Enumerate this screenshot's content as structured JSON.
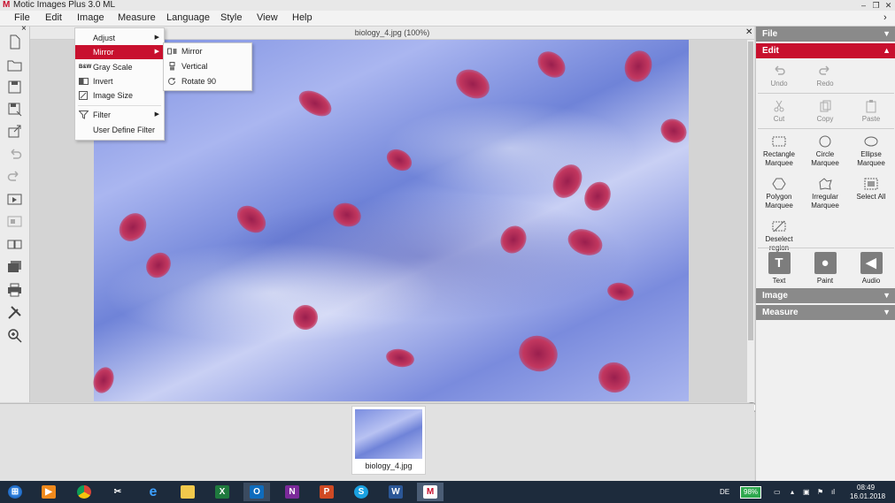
{
  "window": {
    "title": "Motic Images Plus 3.0 ML",
    "logo_text": "M",
    "minimize": "–",
    "restore": "❐",
    "close": "✕"
  },
  "menubar": {
    "items": [
      "File",
      "Edit",
      "Image",
      "Measure",
      "Language",
      "Style",
      "View",
      "Help"
    ],
    "right_chevron": "›"
  },
  "left_toolbar": {
    "icons": [
      "new-file-icon",
      "open-folder-icon",
      "save-icon",
      "save-as-icon",
      "export-icon",
      "undo-icon",
      "redo-icon",
      "slideshow-icon",
      "compare-icon",
      "dual-view-icon",
      "gallery-icon",
      "print-icon",
      "tools-icon",
      "zoom-icon"
    ],
    "panel_close": "×"
  },
  "document": {
    "title": "biology_4.jpg (100%)",
    "close": "✕"
  },
  "image_menu": {
    "items": [
      {
        "label": "Adjust",
        "icon": "",
        "submenu": true
      },
      {
        "label": "Mirror",
        "icon": "mirror-icon",
        "submenu": true,
        "selected": true
      },
      {
        "label": "Gray Scale",
        "icon": "B&W",
        "submenu": false
      },
      {
        "label": "Invert",
        "icon": "invert-icon",
        "submenu": false
      },
      {
        "label": "Image Size",
        "icon": "image-size-icon",
        "submenu": false
      },
      {
        "label": "Filter",
        "icon": "filter-icon",
        "submenu": true
      },
      {
        "label": "User Define Filter",
        "icon": "",
        "submenu": false
      }
    ]
  },
  "mirror_submenu": {
    "items": [
      {
        "label": "Mirror",
        "icon": "mirror-horizontal-icon"
      },
      {
        "label": "Vertical",
        "icon": "mirror-vertical-icon"
      },
      {
        "label": "Rotate 90",
        "icon": "rotate-icon"
      }
    ]
  },
  "thumbnail": {
    "label": "biology_4.jpg"
  },
  "right_panel": {
    "sections": {
      "file": "File",
      "edit": "Edit",
      "image": "Image",
      "measure": "Measure"
    },
    "colors": {
      "header_gray": "#8a8a8a",
      "header_active": "#c8102e"
    },
    "edit_tools": {
      "undo": "Undo",
      "redo": "Redo",
      "cut": "Cut",
      "copy": "Copy",
      "paste": "Paste",
      "rect": "Rectangle Marquee",
      "circle": "Circle Marquee",
      "ellipse": "Ellipse Marquee",
      "polygon": "Polygon Marquee",
      "irregular": "Irregular Marquee",
      "select_all": "Select All",
      "deselect": "Deselect region",
      "text": "Text",
      "paint": "Paint",
      "audio": "Audio"
    }
  },
  "taskbar": {
    "apps": [
      "windows-start",
      "media-player",
      "chrome",
      "snipping",
      "internet-explorer",
      "file-explorer",
      "excel",
      "outlook",
      "onenote",
      "powerpoint",
      "skype",
      "word",
      "motic"
    ],
    "language": "DE",
    "battery": "98%",
    "time": "08:49",
    "date": "16.01.2018"
  }
}
